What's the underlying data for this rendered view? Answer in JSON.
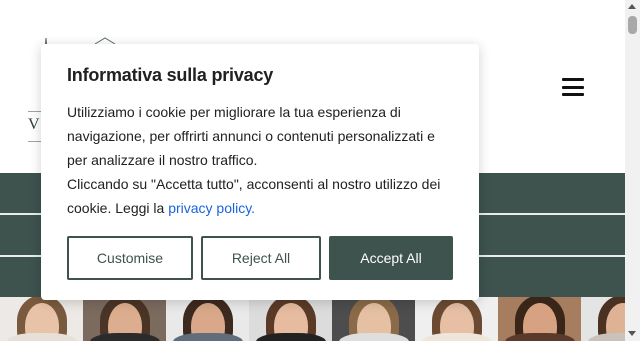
{
  "logo": {
    "letter": "V"
  },
  "cookie_banner": {
    "title": "Informativa sulla privacy",
    "body_line1": "Utilizziamo i cookie per migliorare la tua esperienza di navigazione, per offrirti annunci o contenuti personalizzati e per analizzare il nostro traffico.",
    "body_line2_prefix": "Cliccando su \"Accetta tutto\", acconsenti al nostro utilizzo dei cookie. Leggi la ",
    "privacy_link": "privacy policy.",
    "buttons": {
      "customise": "Customise",
      "reject": "Reject All",
      "accept": "Accept All"
    }
  },
  "colors": {
    "brand_green": "#3e524e",
    "link_blue": "#1863dc",
    "text": "#212121"
  },
  "icons": [
    "hamburger-menu-icon",
    "logo-mark-icon"
  ]
}
